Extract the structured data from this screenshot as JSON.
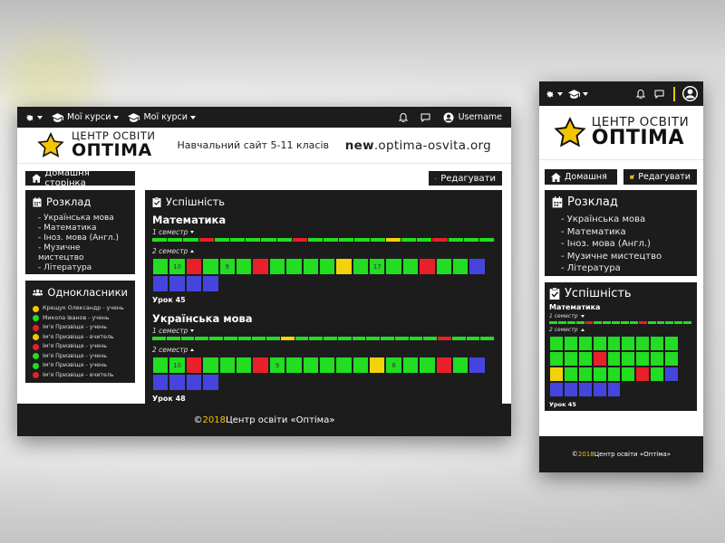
{
  "desktop": {
    "topbar": {
      "my_courses_1": "Мої курси",
      "my_courses_2": "Мої курси",
      "username": "Username"
    },
    "header": {
      "logo_top": "ЦЕНТР ОСВІТИ",
      "logo_bottom": "ОПТІМА",
      "tagline": "Навчальний сайт 5-11 класів",
      "site_bold": "new",
      "site_rest": ".optima-osvita.org"
    },
    "home_button": "Домашня сторінка",
    "edit_button": "Редагувати",
    "schedule": {
      "title": "Розклад",
      "items": [
        "- Українська мова",
        "- Математика",
        "- Іноз. мова (Англ.)",
        "- Музичне мистецтво",
        "- Література"
      ]
    },
    "classmates": {
      "title": "Однокласники",
      "items": [
        "Крещук Олександр - учень",
        "Микола Іванов - учень",
        "Ім'я Призвіще - учень",
        "Ім'я Призвіще - вчитель",
        "Ім'я Призвіще - учень",
        "Ім'я Призвіще - учень",
        "Ім'я Призвіще - учень",
        "Ім'я Призвіще - вчитель"
      ]
    },
    "progress": {
      "title": "Успішність",
      "subjects": [
        {
          "name": "Математика",
          "sem1": "1 семестр",
          "sem2": "2 семестр",
          "lesson": "Урок 45"
        },
        {
          "name": "Українська мова",
          "sem1": "1 семестр",
          "sem2": "2 семестр",
          "lesson": "Урок 48"
        }
      ]
    },
    "footer": {
      "copy": "©",
      "year": "2018",
      "text": " Центр освіти «Оптіма»"
    }
  },
  "mobile": {
    "header": {
      "logo_top": "ЦЕНТР ОСВІТИ",
      "logo_bottom": "ОПТІМА"
    },
    "home_button": "Домашня",
    "edit_button": "Редагувати",
    "schedule": {
      "title": "Розклад",
      "items": [
        "- Українська мова",
        "- Математика",
        "- Іноз. мова (Англ.)",
        "- Музичне мистецтво",
        "- Література"
      ]
    },
    "progress": {
      "title": "Успішність",
      "subject": "Математика",
      "sem1": "1 семестр",
      "sem2": "2 семестр",
      "lesson": "Урок 45"
    },
    "footer": {
      "copy": "©",
      "year": "2018",
      "text": " Центр освіти «Оптіма»"
    }
  },
  "grades": {
    "math_sem2_row1": [
      "",
      "10",
      "",
      "",
      "9",
      "",
      "",
      "",
      "",
      "",
      "",
      "",
      "",
      "17",
      "",
      "",
      "",
      "",
      ""
    ],
    "ukr_sem2_row1": [
      "",
      "10",
      "",
      "",
      "",
      "",
      "",
      "9",
      "",
      "",
      "",
      "",
      "",
      "",
      "8",
      "",
      "",
      "",
      ""
    ]
  },
  "colors": {
    "green": "#22dd22",
    "red": "#e8202a",
    "yellow": "#f2d20a",
    "blue": "#4545dd",
    "dark": "#1c1c1c",
    "accent": "#f5c400"
  }
}
